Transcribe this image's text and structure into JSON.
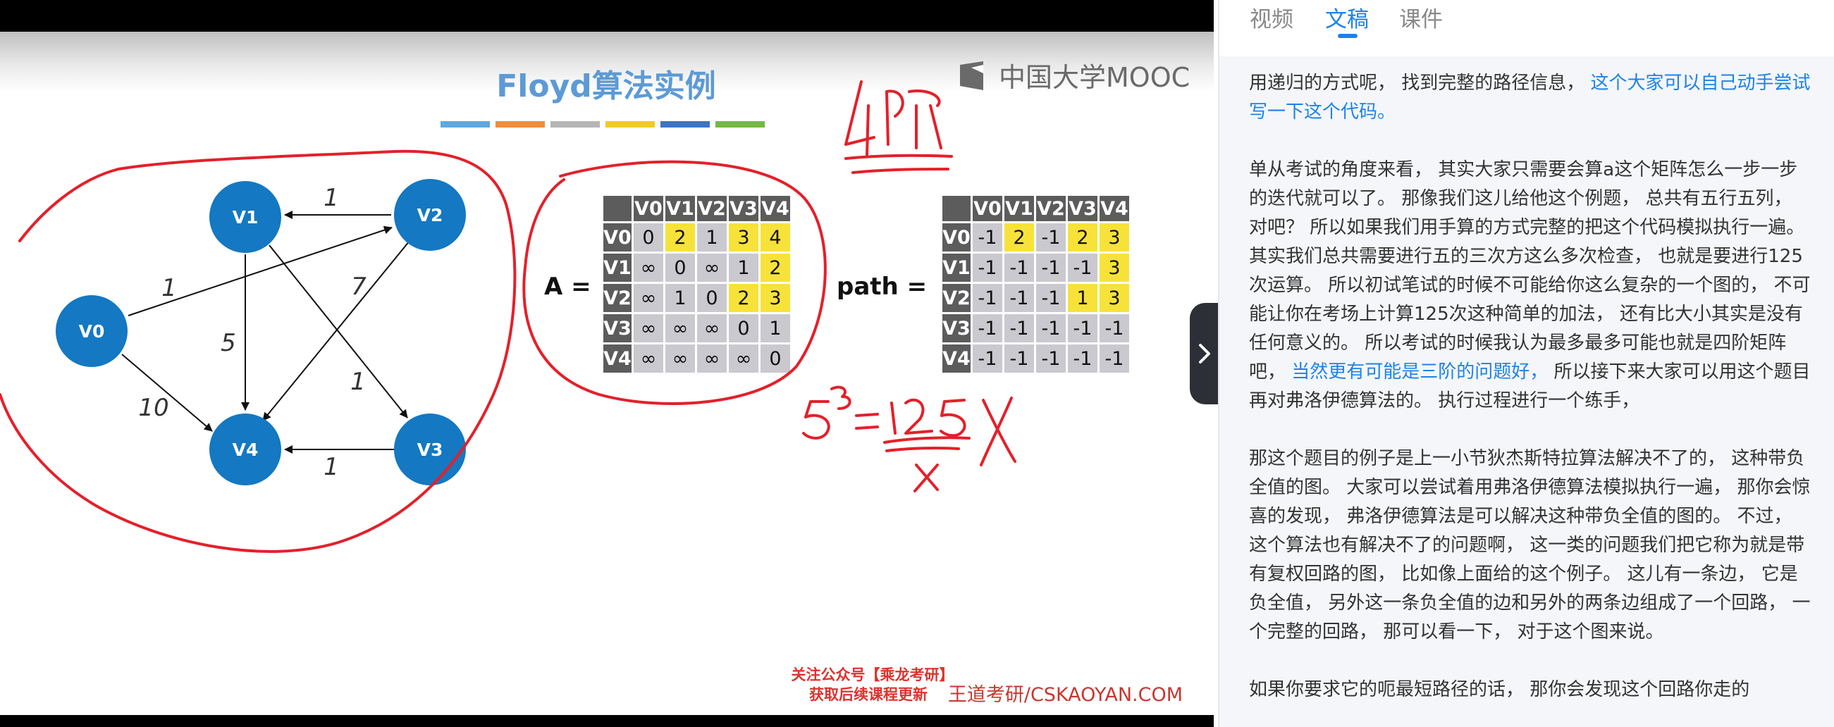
{
  "slide": {
    "title": "Floyd算法实例",
    "brand": "中国大学MOOC",
    "nodes": [
      "V0",
      "V1",
      "V2",
      "V3",
      "V4"
    ],
    "edges": [
      {
        "from": "V2",
        "to": "V1",
        "weight": "1"
      },
      {
        "from": "V0",
        "to": "V2",
        "weight": "1"
      },
      {
        "from": "V0",
        "to": "V4",
        "weight": "10"
      },
      {
        "from": "V1",
        "to": "V4",
        "weight": "5"
      },
      {
        "from": "V1",
        "to": "V3",
        "weight": "1"
      },
      {
        "from": "V2",
        "to": "V4",
        "weight": "7"
      },
      {
        "from": "V3",
        "to": "V4",
        "weight": "1"
      }
    ],
    "matrix_a": {
      "label": "A =",
      "headers": [
        "V0",
        "V1",
        "V2",
        "V3",
        "V4"
      ],
      "rows": [
        {
          "head": "V0",
          "cells": [
            "0",
            "2",
            "1",
            "3",
            "4"
          ]
        },
        {
          "head": "V1",
          "cells": [
            "∞",
            "0",
            "∞",
            "1",
            "2"
          ]
        },
        {
          "head": "V2",
          "cells": [
            "∞",
            "1",
            "0",
            "2",
            "3"
          ]
        },
        {
          "head": "V3",
          "cells": [
            "∞",
            "∞",
            "∞",
            "0",
            "1"
          ]
        },
        {
          "head": "V4",
          "cells": [
            "∞",
            "∞",
            "∞",
            "∞",
            "0"
          ]
        }
      ]
    },
    "matrix_path": {
      "label": "path =",
      "headers": [
        "V0",
        "V1",
        "V2",
        "V3",
        "V4"
      ],
      "rows": [
        {
          "head": "V0",
          "cells": [
            "-1",
            "2",
            "-1",
            "2",
            "3"
          ]
        },
        {
          "head": "V1",
          "cells": [
            "-1",
            "-1",
            "-1",
            "-1",
            "3"
          ]
        },
        {
          "head": "V2",
          "cells": [
            "-1",
            "-1",
            "-1",
            "1",
            "3"
          ]
        },
        {
          "head": "V3",
          "cells": [
            "-1",
            "-1",
            "-1",
            "-1",
            "-1"
          ]
        },
        {
          "head": "V4",
          "cells": [
            "-1",
            "-1",
            "-1",
            "-1",
            "-1"
          ]
        }
      ]
    },
    "watermark_line1": "关注公众号【乘龙考研】",
    "watermark_line2": "获取后续课程更新",
    "site": "王道考研/CSKAOYAN.COM",
    "colors": {
      "title": "#5d9ad6",
      "node": "#1478c2",
      "highlight": "#f7e23a",
      "matrix_head": "#5c5c5c",
      "matrix_cell": "#c9c9cf",
      "ink": "#e4202a"
    }
  },
  "tabs": [
    {
      "label": "视频",
      "active": false
    },
    {
      "label": "文稿",
      "active": true
    },
    {
      "label": "课件",
      "active": false
    }
  ],
  "toggle_icon": "chevron-right-icon",
  "transcript": [
    [
      {
        "text": "用递归的方式呢， 找到完整的路径信息， ",
        "hl": false
      },
      {
        "text": "这个大家可以自己动手尝试写一下这个代码。",
        "hl": true
      }
    ],
    [
      {
        "text": "单从考试的角度来看， 其实大家只需要会算a这个矩阵怎么一步一步的迭代就可以了。 那像我们这儿给他这个例题， 总共有五行五列， 对吧？ 所以如果我们用手算的方式完整的把这个代码模拟执行一遍。 其实我们总共需要进行五的三次方这么多次检查， 也就是要进行125次运算。 所以初试笔试的时候不可能给你这么复杂的一个图的， 不可能让你在考场上计算125次这种简单的加法， 还有比大小其实是没有任何意义的。 所以考试的时候我认为最多最多可能也就是四阶矩阵吧， ",
        "hl": false
      },
      {
        "text": "当然更有可能是三阶的问题好，",
        "hl": true
      },
      {
        "text": " 所以接下来大家可以用这个题目再对弗洛伊德算法的。 执行过程进行一个练手，",
        "hl": false
      }
    ],
    [
      {
        "text": "那这个题目的例子是上一小节狄杰斯特拉算法解决不了的， 这种带负全值的图。 大家可以尝试着用弗洛伊德算法模拟执行一遍， 那你会惊喜的发现， 弗洛伊德算法是可以解决这种带负全值的图的。 不过， 这个算法也有解决不了的问题啊， 这一类的问题我们把它称为就是带有复权回路的图， 比如像上面给的这个例子。 这儿有一条边， 它是负全值， 另外这一条负全值的边和另外的两条边组成了一个回路， 一个完整的回路， 那可以看一下， 对于这个图来说。",
        "hl": false
      }
    ],
    [
      {
        "text": "如果你要求它的呃最短路径的话， 那你会发现这个回路你走的",
        "hl": false
      }
    ]
  ]
}
